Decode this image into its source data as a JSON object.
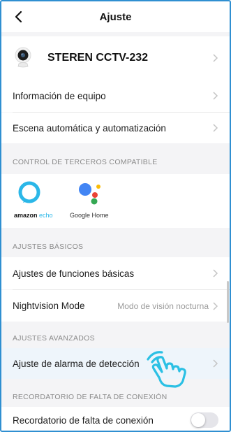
{
  "header": {
    "title": "Ajuste"
  },
  "device": {
    "name": "STEREN CCTV-232"
  },
  "rows": {
    "device_info": "Información de equipo",
    "automation": "Escena automática y automatización",
    "basic_functions": "Ajustes de funciones básicas",
    "nightvision": "Nightvision Mode",
    "nightvision_value": "Modo de visión nocturna",
    "alarm": "Ajuste de alarma de detección",
    "offline_reminder": "Recordatorio de falta de conexión"
  },
  "sections": {
    "third_party": "CONTROL DE TERCEROS COMPATIBLE",
    "basic": "AJUSTES BÁSICOS",
    "advanced": "AJUSTES AVANZADOS",
    "offline": "RECORDATORIO DE FALTA DE CONEXIÓN"
  },
  "partners": {
    "amazon_a": "amazon",
    "amazon_b": "echo",
    "google": "Google Home"
  },
  "toggle_offline_reminder": {
    "on": false
  },
  "colors": {
    "accent_border": "#2f8fd1",
    "alexa": "#2bb7e8",
    "hand_cursor": "#2bc0e4"
  }
}
